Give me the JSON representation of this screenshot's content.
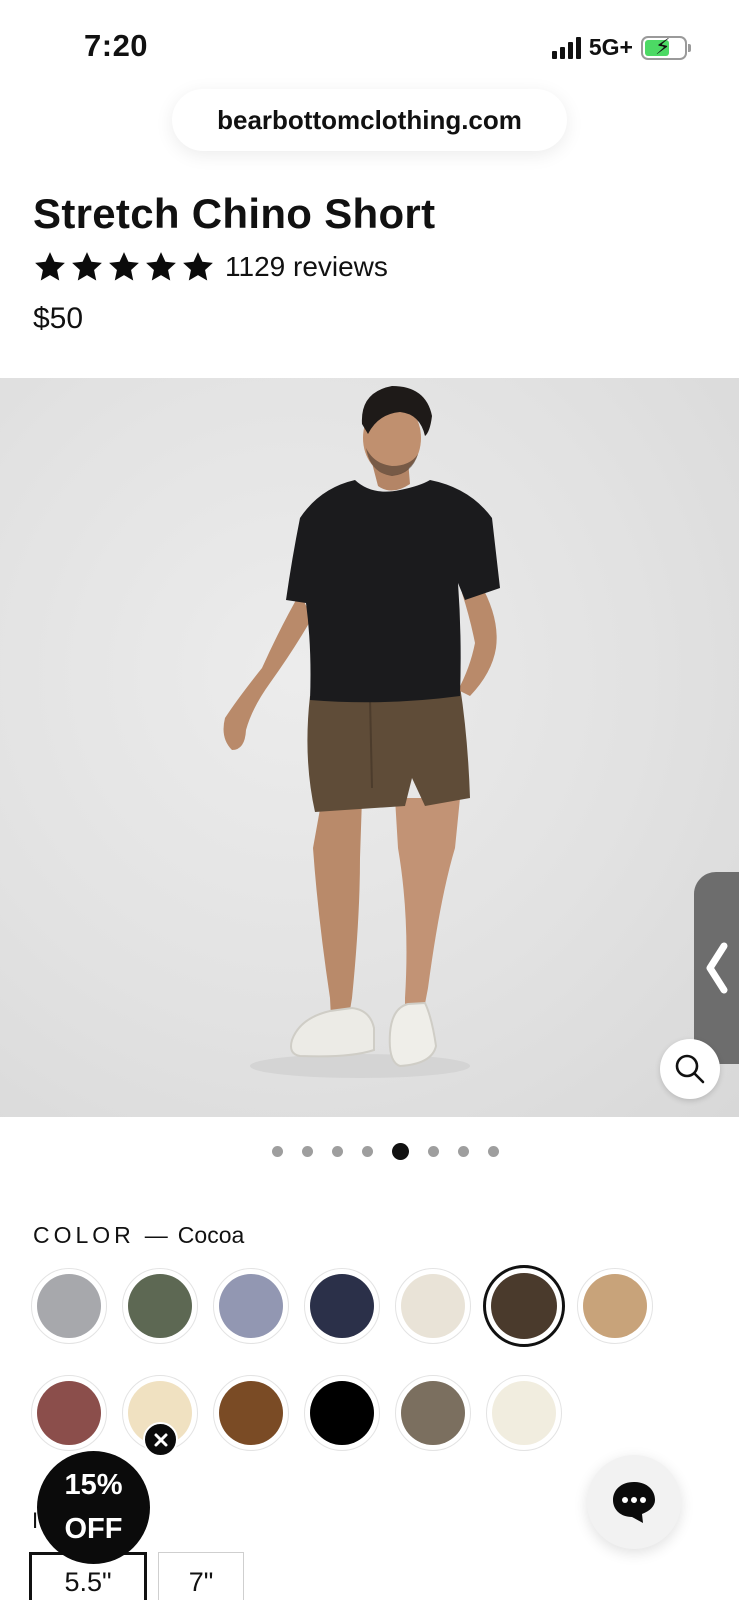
{
  "status_bar": {
    "time": "7:20",
    "network": "5G+",
    "battery_level": 0.62,
    "battery_color": "#4cd964"
  },
  "browser": {
    "url": "bearbottomclothing.com"
  },
  "product": {
    "title": "Stretch Chino Short",
    "rating_stars": 5,
    "review_count": "1129 reviews",
    "price": "$50"
  },
  "gallery": {
    "image_count": 8,
    "active_index": 4,
    "zoom_icon": "search-icon",
    "side_tab_icon": "chevron-left-icon"
  },
  "color": {
    "label": "COLOR",
    "separator": "—",
    "selected_name": "Cocoa",
    "swatches": [
      {
        "color": "#a7a8ac",
        "selected": false
      },
      {
        "color": "#5d6853",
        "selected": false
      },
      {
        "color": "#9297b2",
        "selected": false
      },
      {
        "color": "#2b3049",
        "selected": false
      },
      {
        "color": "#e9e3d7",
        "selected": false
      },
      {
        "color": "#4a3a2c",
        "selected": true
      },
      {
        "color": "#c8a37a",
        "selected": false
      },
      {
        "color": "#8b4e4b",
        "selected": false
      },
      {
        "color": "#f0e1c1",
        "selected": false
      },
      {
        "color": "#7a4b25",
        "selected": false
      },
      {
        "color": "#000000",
        "selected": false
      },
      {
        "color": "#7b6f5f",
        "selected": false
      },
      {
        "color": "#f1eddf",
        "selected": false
      }
    ]
  },
  "promo": {
    "line1": "15%",
    "line2": "OFF"
  },
  "length": {
    "label_initial": "I",
    "options": [
      {
        "label": "5.5\"",
        "selected": true
      },
      {
        "label": "7\"",
        "selected": false
      }
    ]
  },
  "chat": {
    "icon": "chat-bubble-icon"
  }
}
